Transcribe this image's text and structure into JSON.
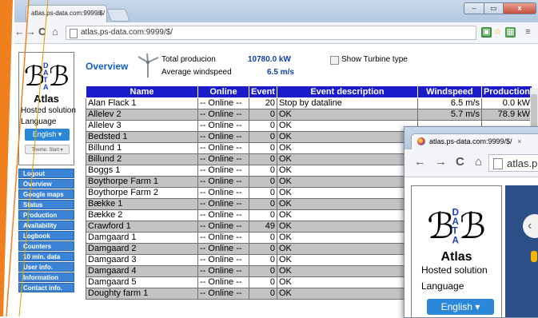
{
  "browser": {
    "tab_title": "atlas.ps-data.com:9999/$/",
    "tab_close": "×",
    "url": "atlas.ps-data.com:9999/$/",
    "window_controls": {
      "minimize": "–",
      "maximize": "▭",
      "close": "x"
    }
  },
  "sidebar": {
    "title": "Atlas",
    "subtitle": "Hosted solution",
    "language_label": "Language",
    "language_value": "English",
    "theme_value": "Theme: Start",
    "menu": [
      "Logout",
      "Overview",
      "Google maps",
      "Status",
      "Production",
      "Availability",
      "Logbook",
      "Counters",
      "10 min. data",
      "User info.",
      "Information",
      "Contact info."
    ]
  },
  "overview": {
    "title": "Overview",
    "total_production_label": "Total producion",
    "total_production_value": "10780.0 kW",
    "avg_windspeed_label": "Average windspeed",
    "avg_windspeed_value": "6.5 m/s",
    "show_turbine_label": "Show Turbine type"
  },
  "table": {
    "columns": [
      "Name",
      "Online",
      "Event",
      "Event description",
      "Windspeed",
      "Production"
    ],
    "rows": [
      [
        "Alan Flack 1",
        "-- Online --",
        "20",
        "Stop by dataline",
        "6.5 m/s",
        "0.0 kW"
      ],
      [
        "Allelev 2",
        "-- Online --",
        "0",
        "OK",
        "5.7 m/s",
        "78.9 kW"
      ],
      [
        "Allelev 3",
        "-- Online --",
        "0",
        "OK",
        "",
        ""
      ],
      [
        "Bedsted 1",
        "-- Online --",
        "0",
        "OK",
        "",
        ""
      ],
      [
        "Billund 1",
        "-- Online --",
        "0",
        "OK",
        "",
        ""
      ],
      [
        "Billund 2",
        "-- Online --",
        "0",
        "OK",
        "",
        ""
      ],
      [
        "Boggs 1",
        "-- Online --",
        "0",
        "OK",
        "",
        ""
      ],
      [
        "Boythorpe Farm 1",
        "-- Online --",
        "0",
        "OK",
        "",
        ""
      ],
      [
        "Boythorpe Farm 2",
        "-- Online --",
        "0",
        "OK",
        "",
        ""
      ],
      [
        "Bække 1",
        "-- Online --",
        "0",
        "OK",
        "",
        ""
      ],
      [
        "Bække 2",
        "-- Online --",
        "0",
        "OK",
        "",
        ""
      ],
      [
        "Crawford 1",
        "-- Online --",
        "49",
        "OK",
        "",
        ""
      ],
      [
        "Damgaard 1",
        "-- Online --",
        "0",
        "OK",
        "",
        ""
      ],
      [
        "Damgaard 2",
        "-- Online --",
        "0",
        "OK",
        "",
        ""
      ],
      [
        "Damgaard 3",
        "-- Online --",
        "0",
        "OK",
        "",
        ""
      ],
      [
        "Damgaard 4",
        "-- Online --",
        "0",
        "OK",
        "",
        ""
      ],
      [
        "Damgaard 5",
        "-- Online --",
        "0",
        "OK",
        "",
        ""
      ],
      [
        "Doughty farm 1",
        "-- Online --",
        "0",
        "OK",
        "",
        ""
      ]
    ]
  },
  "popup_window": {
    "tab_title": "atlas.ps-data.com:9999/$/",
    "tab_close": "×",
    "url": "atlas.p",
    "title": "Atlas",
    "subtitle": "Hosted solution",
    "language_label": "Language",
    "language_value": "English"
  },
  "colors": {
    "frame_orange": "#f07f1e",
    "header_blue": "#1b1bc9",
    "menu_blue": "#3b83d7",
    "row_gray": "#c3c3c3",
    "accent_blue": "#1060c8"
  },
  "icons": [
    "back-icon",
    "forward-icon",
    "reload-icon",
    "home-icon",
    "page-icon",
    "extension-icon",
    "star-icon",
    "menu-icon",
    "turbine-icon",
    "chevron-down-icon"
  ]
}
